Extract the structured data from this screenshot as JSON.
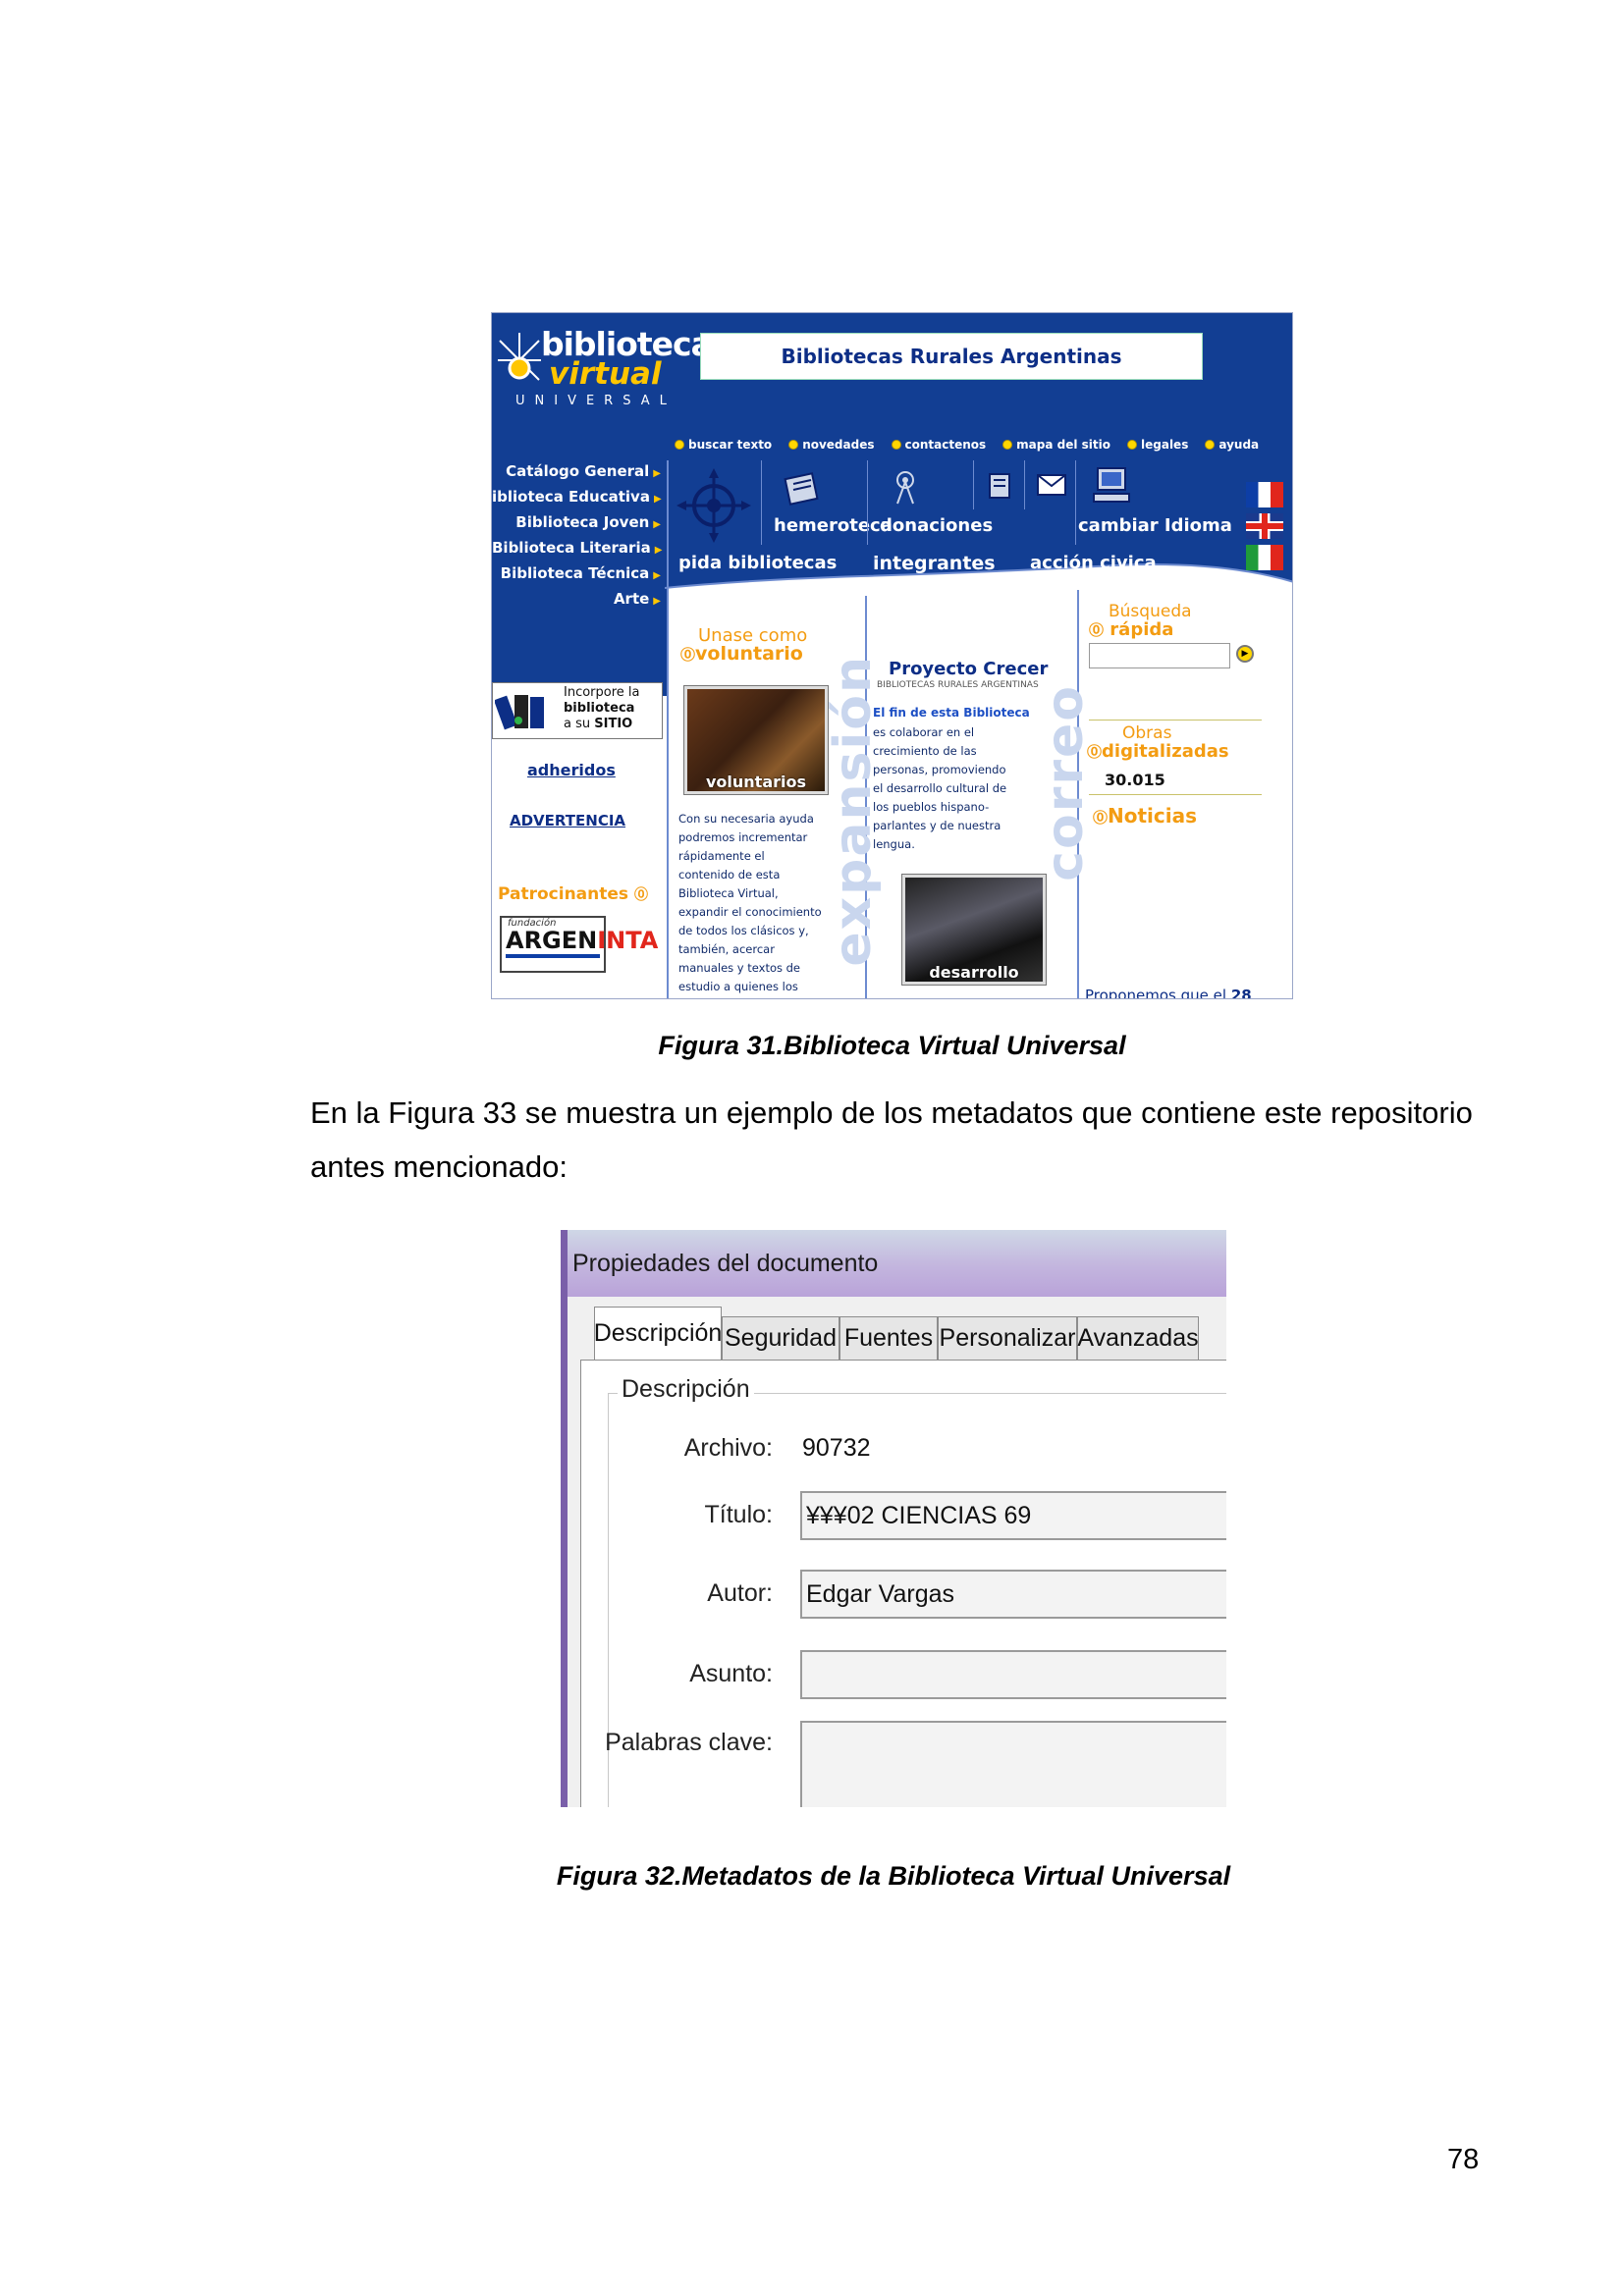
{
  "figure31": {
    "logo": {
      "line1": "biblioteca",
      "line2": "virtual",
      "line3": "UNIVERSAL"
    },
    "banner": "Bibliotecas Rurales Argentinas",
    "top_links": [
      "buscar texto",
      "novedades",
      "contactenos",
      "mapa del sitio",
      "legales",
      "ayuda"
    ],
    "left_menu": [
      "Catálogo General",
      "iblioteca Educativa",
      "Biblioteca Joven",
      "Biblioteca Literaria",
      "Biblioteca Técnica",
      "Arte"
    ],
    "nav_row1": [
      "hemeroteca",
      "donaciones",
      "cambiar Idioma"
    ],
    "nav_row2": [
      "pida bibliotecas",
      "integrantes",
      "acción civica"
    ],
    "incorpore": {
      "line1": "Incorpore la",
      "line2": "biblioteca",
      "line3": "a su",
      "line3b": "SITIO"
    },
    "links": {
      "adheridos": "adheridos",
      "advertencia": "ADVERTENCIA",
      "patrocinantes": "Patrocinantes"
    },
    "sponsor": {
      "top": "fundación",
      "name1": "ARGEN",
      "name2": "INTA"
    },
    "voluntario": {
      "heading1": "Unase como",
      "heading2": "voluntario",
      "photo_caption": "voluntarios",
      "text": [
        "Con su necesaria ayuda",
        "podremos incrementar",
        "rápidamente el",
        "contenido de esta",
        "Biblioteca Virtual,",
        "expandir el conocimiento",
        "de todos los clásicos y,",
        "también, acercar",
        "manuales y textos de",
        "estudio a quienes los"
      ]
    },
    "watermarks": {
      "center": "expansión",
      "right": "correo"
    },
    "proyecto": {
      "title": "Proyecto Crecer",
      "subtitle": "BIBLIOTECAS RURALES ARGENTINAS",
      "lead": "El fin de esta Biblioteca",
      "text": [
        "es colaborar en el",
        "crecimiento de las",
        "personas, promoviendo",
        "el desarrollo cultural de",
        "los pueblos hispano-",
        "parlantes y de nuestra",
        "lengua."
      ],
      "photo_caption": "desarrollo"
    },
    "right": {
      "busqueda1": "Búsqueda",
      "busqueda2": "rápida",
      "obras1": "Obras",
      "obras2": "digitalizadas",
      "count": "30.015",
      "noticias": "Noticias",
      "bottom": "Proponemos que el",
      "bottom_num": "28"
    },
    "caption": "Figura 31.Biblioteca Virtual Universal"
  },
  "paragraph": {
    "line1": "En la Figura 33 se muestra un ejemplo de los metadatos que contiene este repositorio",
    "line2": "antes mencionado:"
  },
  "figure32": {
    "title": "Propiedades del documento",
    "tabs": [
      "Descripción",
      "Seguridad",
      "Fuentes",
      "Personalizar",
      "Avanzadas"
    ],
    "group": "Descripción",
    "fields": {
      "archivo_label": "Archivo:",
      "archivo_value": "90732",
      "titulo_label": "Título:",
      "titulo_value": "¥¥¥02 CIENCIAS 69",
      "autor_label": "Autor:",
      "autor_value": "Edgar Vargas",
      "asunto_label": "Asunto:",
      "asunto_value": "",
      "palabras_label": "Palabras clave:",
      "palabras_value": ""
    },
    "caption": "Figura 32.Metadatos de la  Biblioteca Virtual Universal"
  },
  "page_number": "78"
}
